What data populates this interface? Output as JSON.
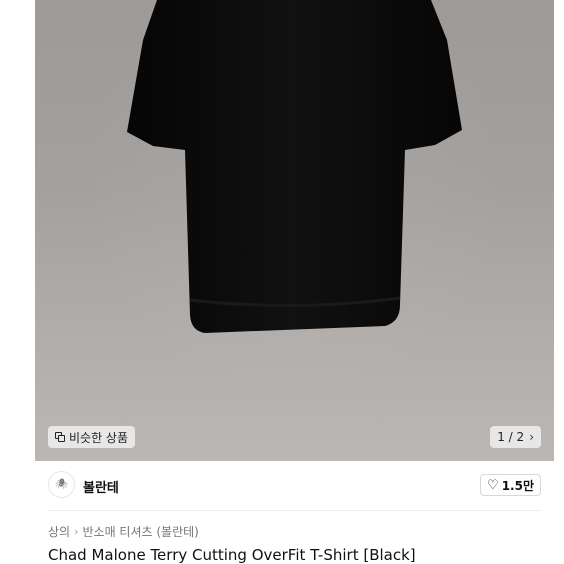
{
  "product": {
    "similar_label": "비슷한 상품",
    "pager": "1 / 2",
    "brand_name": "볼란테",
    "brand_logo_text": "🕷",
    "likes": "1.5만",
    "breadcrumb": [
      "상의",
      "반소매 티셔츠 (볼란테)"
    ],
    "title": "Chad Malone Terry Cutting OverFit T-Shirt [Black]"
  },
  "icons": {
    "similar": "similar-items-icon",
    "chevron": "chevron-right-icon",
    "heart": "heart-outline-icon"
  },
  "colors": {
    "background": "#a3a09e",
    "shirt": "#0b0b0b"
  }
}
